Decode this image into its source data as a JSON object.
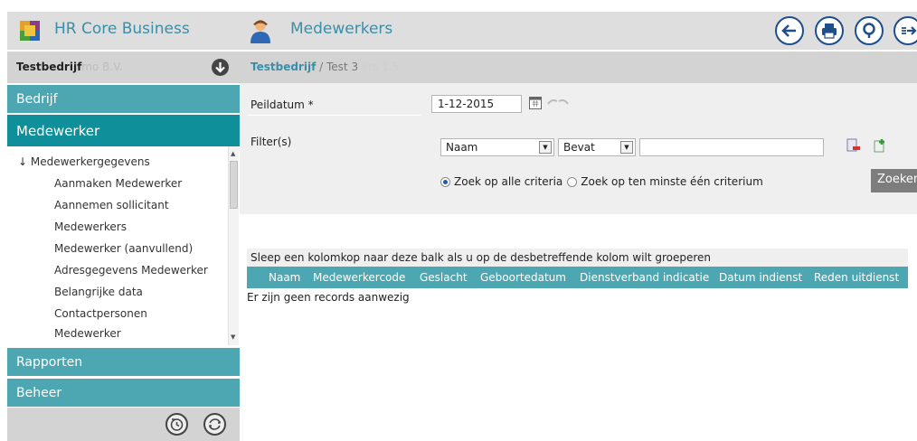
{
  "header": {
    "app_title": "HR Core Business",
    "page_title": "Medewerkers",
    "buttons": [
      "back-icon",
      "print-icon",
      "help-icon",
      "logout-icon"
    ]
  },
  "sidebar": {
    "company": {
      "name": "Testbedrijf",
      "faded_suffix": "mo B.V."
    },
    "nav": [
      {
        "label": "Bedrijf"
      },
      {
        "label": "Medewerker"
      },
      {
        "label": "Rapporten"
      },
      {
        "label": "Beheer"
      }
    ],
    "group_label": "↓ Medewerkergegevens",
    "items": [
      "Aanmaken Medewerker",
      "Aannemen sollicitant",
      "Medewerkers",
      "Medewerker (aanvullend)",
      "Adresgegevens Medewerker",
      "Belangrijke data",
      "Contactpersonen",
      "Medewerker"
    ]
  },
  "breadcrumb": {
    "company": "Testbedrijf",
    "separator": "/",
    "current": "Test 3",
    "faded": "ers 1.5"
  },
  "filter": {
    "peildatum_label": "Peildatum *",
    "peildatum_value": "1-12-2015",
    "filters_label": "Filter(s)",
    "field_select": "Naam",
    "operator_select": "Bevat",
    "value": "",
    "radio_all": "Zoek op alle criteria",
    "radio_any": "Zoek op ten minste één criterium",
    "search_button": "Zoeken"
  },
  "grid": {
    "group_hint": "Sleep een kolomkop naar deze balk als u op de desbetreffende kolom wilt groeperen",
    "columns": [
      "Naam",
      "Medewerkercode",
      "Geslacht",
      "Geboortedatum",
      "Dienstverband indicatie",
      "Datum indienst",
      "Reden uitdienst"
    ],
    "empty_message": "Er zijn geen records aanwezig"
  },
  "colors": {
    "accent": "#4da7b2",
    "accent_active": "#0f8f99",
    "title": "#3a8ea8",
    "header_bg": "#dedede",
    "button_ring": "#1e4e8c"
  }
}
